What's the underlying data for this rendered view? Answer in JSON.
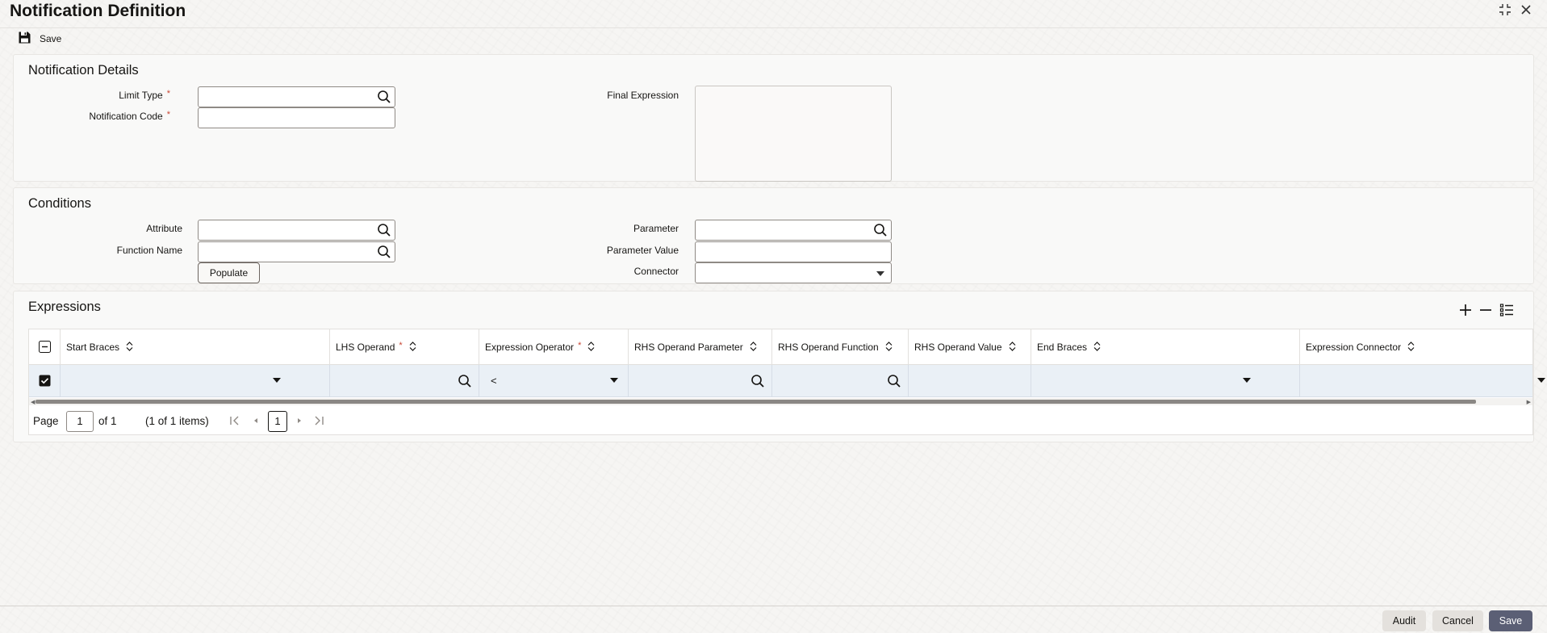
{
  "window": {
    "title": "Notification Definition"
  },
  "toolbar": {
    "save_label": "Save"
  },
  "notification_details": {
    "section_title": "Notification Details",
    "limit_type_label": "Limit Type",
    "limit_type_value": "",
    "notification_code_label": "Notification Code",
    "notification_code_value": "",
    "final_expression_label": "Final Expression",
    "final_expression_value": "",
    "required_mark": "*"
  },
  "conditions": {
    "section_title": "Conditions",
    "attribute_label": "Attribute",
    "attribute_value": "",
    "function_name_label": "Function Name",
    "function_name_value": "",
    "populate_label": "Populate",
    "parameter_label": "Parameter",
    "parameter_value_field": "",
    "parameter_value_label": "Parameter Value",
    "parameter_value_value": "",
    "connector_label": "Connector",
    "connector_value": ""
  },
  "expressions": {
    "section_title": "Expressions",
    "columns": [
      "Start Braces",
      "LHS Operand",
      "Expression Operator",
      "RHS Operand Parameter",
      "RHS Operand Function",
      "RHS Operand Value",
      "End Braces",
      "Expression Connector"
    ],
    "rows": [
      {
        "selected": true,
        "start_braces": "",
        "lhs_operand": "",
        "expression_operator": "<",
        "rhs_operand_parameter": "",
        "rhs_operand_function": "",
        "rhs_operand_value": "",
        "end_braces": "",
        "expression_connector": ""
      }
    ],
    "pager": {
      "page_label": "Page",
      "page_value": "1",
      "of_label": "of 1",
      "items_label": "(1 of 1 items)",
      "current_page": "1"
    }
  },
  "footer": {
    "audit_label": "Audit",
    "cancel_label": "Cancel",
    "save_label": "Save"
  },
  "colors": {
    "required": "#c74634",
    "selected_row": "#eaf0f6",
    "primary_button": "#5b5f75"
  },
  "icons": [
    "collapse-icon",
    "close-icon",
    "save-icon",
    "search-icon",
    "dropdown-caret-icon",
    "add-row-icon",
    "remove-row-icon",
    "column-manager-icon",
    "sort-icon",
    "first-page-icon",
    "prev-page-icon",
    "next-page-icon",
    "last-page-icon",
    "checkbox-icon"
  ]
}
